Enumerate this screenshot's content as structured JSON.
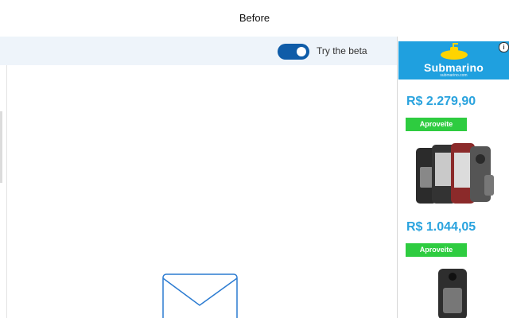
{
  "window": {
    "title": "Before"
  },
  "toolbar": {
    "beta_toggle_on": true,
    "beta_label": "Try the beta"
  },
  "ad": {
    "brand": "Submarino",
    "brand_sub": "submarino.com",
    "info_glyph": "i",
    "products": [
      {
        "price": "R$ 2.279,90",
        "cta": "Aproveite",
        "image": "smartphone-group"
      },
      {
        "price": "R$ 1.044,05",
        "cta": "Aproveite",
        "image": "smartphone-back"
      }
    ]
  },
  "colors": {
    "accent": "#0f5ca8",
    "ad_blue": "#1fa0df",
    "ad_green": "#2ecc40",
    "price_blue": "#2aa3de"
  }
}
